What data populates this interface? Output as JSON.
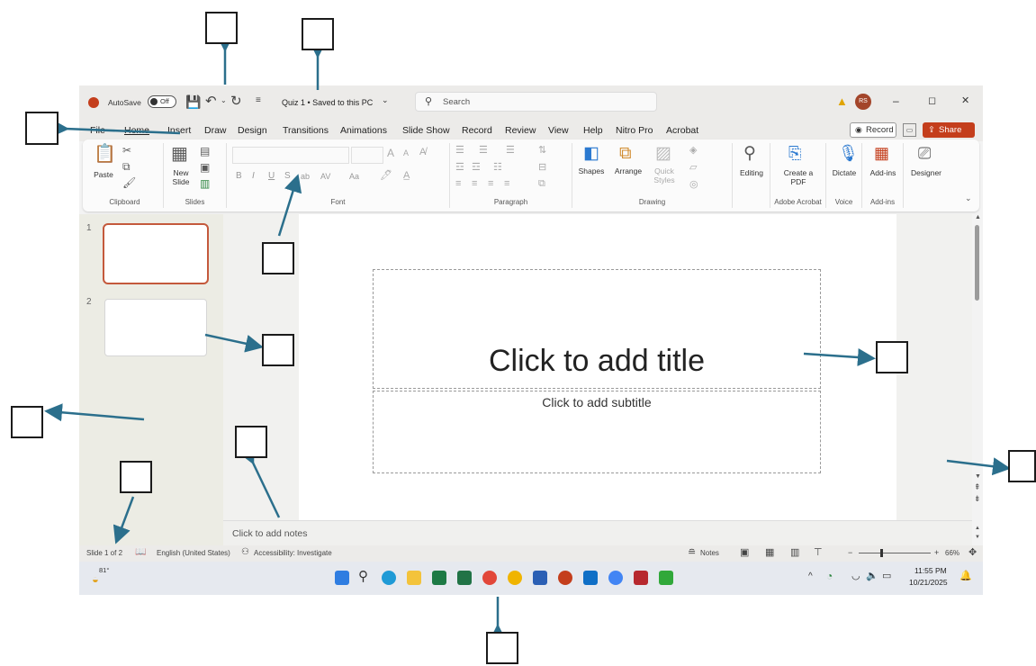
{
  "titlebar": {
    "autosave_label": "AutoSave",
    "autosave_state": "Off",
    "doc_title": "Quiz 1 • Saved to this PC",
    "search_placeholder": "Search",
    "user_initials": "RS",
    "controls": [
      "–",
      "◻",
      "✕"
    ]
  },
  "menu": {
    "tabs": [
      "File",
      "Home",
      "Insert",
      "Draw",
      "Design",
      "Transitions",
      "Animations",
      "Slide Show",
      "Record",
      "Review",
      "View",
      "Help",
      "Nitro Pro",
      "Acrobat"
    ],
    "record_button": "Record",
    "share_button": "Share"
  },
  "ribbon": {
    "clipboard": {
      "label": "Clipboard",
      "paste": "Paste"
    },
    "slides": {
      "label": "Slides",
      "new_slide": "New Slide"
    },
    "font": {
      "label": "Font",
      "bold": "B",
      "italic": "I",
      "underline": "U",
      "strike": "S",
      "abc": "ab",
      "spacing": "AV",
      "case": "Aa",
      "grow": "A",
      "shrink": "A"
    },
    "paragraph": {
      "label": "Paragraph"
    },
    "drawing": {
      "label": "Drawing",
      "shapes": "Shapes",
      "arrange": "Arrange",
      "quick_styles": "Quick Styles"
    },
    "editing": {
      "label": "Editing"
    },
    "adobe": {
      "label": "Adobe Acrobat",
      "create_pdf": "Create a PDF"
    },
    "voice": {
      "label": "Voice",
      "dictate": "Dictate"
    },
    "addins": {
      "label": "Add-ins",
      "addins_btn": "Add-ins"
    },
    "designer": {
      "label": "Designer"
    }
  },
  "thumbnails": {
    "numbers": [
      "1",
      "2"
    ]
  },
  "slide": {
    "title_placeholder": "Click to add title",
    "subtitle_placeholder": "Click to add subtitle"
  },
  "notes": {
    "placeholder": "Click to add notes"
  },
  "statusbar": {
    "slide_count": "Slide 1 of 2",
    "language": "English (United States)",
    "accessibility": "Accessibility: Investigate",
    "notes": "Notes",
    "zoom": "66%"
  },
  "taskbar": {
    "weather": "81°",
    "time": "11:55 PM",
    "date": "10/21/2025"
  },
  "colors": {
    "accent": "#c43e1c",
    "share": "#c43e1c",
    "arrow": "#2b6f8c"
  }
}
